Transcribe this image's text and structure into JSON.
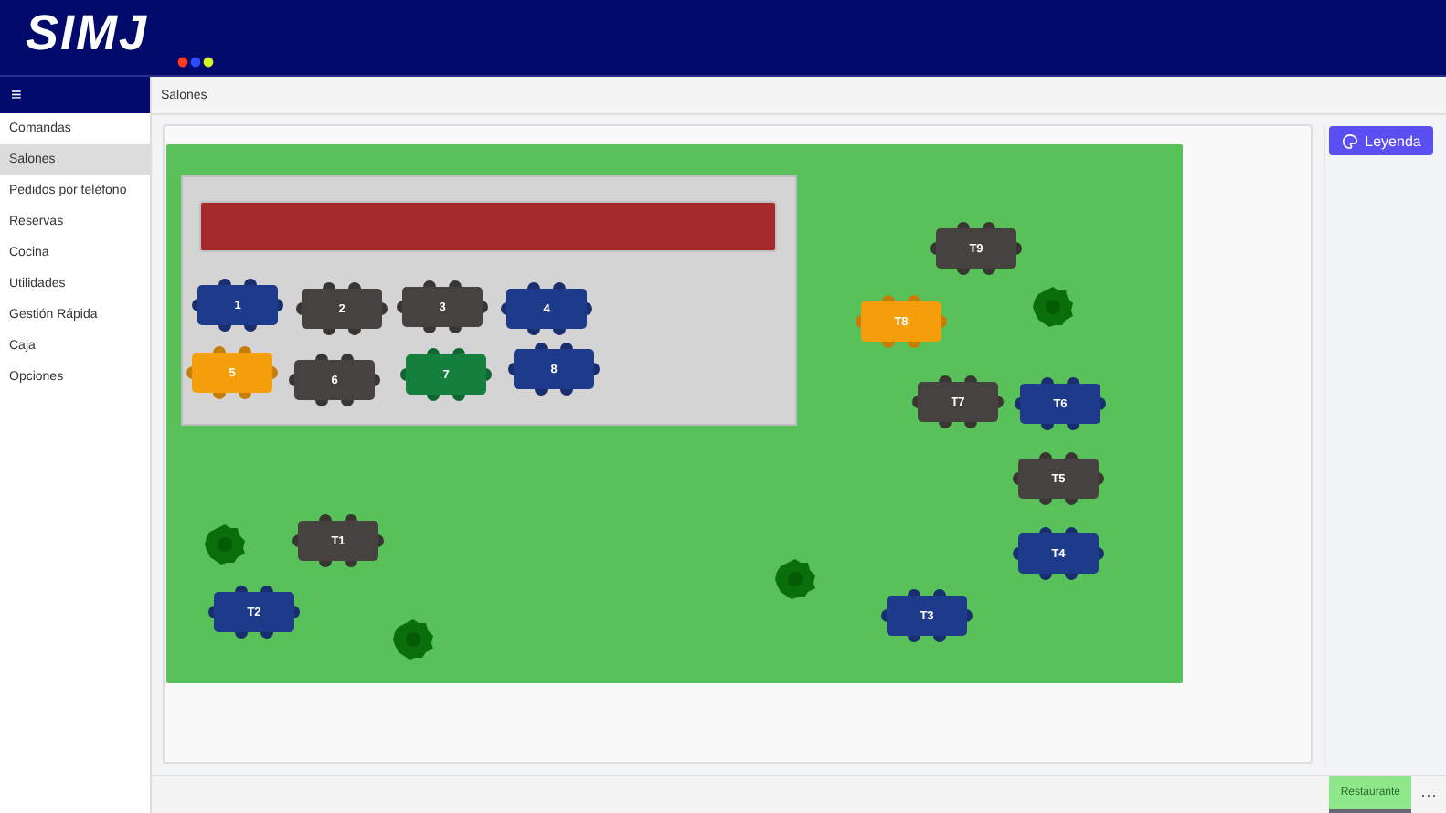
{
  "header": {
    "logo": "SIMJ"
  },
  "menu_button": "≡",
  "sidebar": {
    "items": [
      {
        "label": "Comandas",
        "selected": false
      },
      {
        "label": "Salones",
        "selected": true
      },
      {
        "label": "Pedidos por teléfono",
        "selected": false
      },
      {
        "label": "Reservas",
        "selected": false
      },
      {
        "label": "Cocina",
        "selected": false
      },
      {
        "label": "Utilidades",
        "selected": false
      },
      {
        "label": "Gestión Rápida",
        "selected": false
      },
      {
        "label": "Caja",
        "selected": false
      },
      {
        "label": "Opciones",
        "selected": false
      }
    ]
  },
  "breadcrumb": "Salones",
  "floor_plan": {
    "tables": [
      {
        "label": "1",
        "color": "#1e3a8a"
      },
      {
        "label": "2",
        "color": "#46423f"
      },
      {
        "label": "3",
        "color": "#46423f"
      },
      {
        "label": "4",
        "color": "#1e3a8a"
      },
      {
        "label": "5",
        "color": "#f59e0b"
      },
      {
        "label": "6",
        "color": "#46423f"
      },
      {
        "label": "7",
        "color": "#15803d"
      },
      {
        "label": "8",
        "color": "#1e3a8a"
      },
      {
        "label": "T9",
        "color": "#46423f"
      },
      {
        "label": "T8",
        "color": "#f59e0b"
      },
      {
        "label": "T7",
        "color": "#46423f"
      },
      {
        "label": "T6",
        "color": "#1e3a8a"
      },
      {
        "label": "T5",
        "color": "#46423f"
      },
      {
        "label": "T4",
        "color": "#1e3a8a"
      },
      {
        "label": "T3",
        "color": "#1e3a8a"
      },
      {
        "label": "T1",
        "color": "#46423f"
      },
      {
        "label": "T2",
        "color": "#1e3a8a"
      }
    ]
  },
  "legend_button": "Leyenda",
  "footer": {
    "tabs": [
      {
        "label": "Restaurante",
        "selected": true
      }
    ],
    "more": "···"
  }
}
